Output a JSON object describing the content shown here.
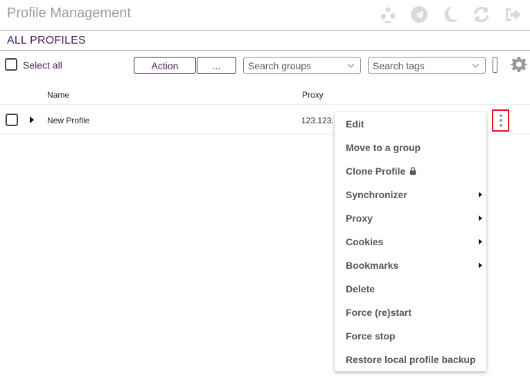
{
  "app": {
    "title": "Profile Management"
  },
  "header": {
    "icons": [
      {
        "name": "recycle-icon"
      },
      {
        "name": "telegram-icon"
      },
      {
        "name": "dark-mode-moon-icon"
      },
      {
        "name": "sync-icon"
      },
      {
        "name": "logout-icon"
      }
    ]
  },
  "section": {
    "title": "ALL PROFILES"
  },
  "toolbar": {
    "select_all_label": "Select all",
    "action_label": "Action",
    "more_label": "...",
    "groups_placeholder": "Search groups",
    "tags_placeholder": "Search tags"
  },
  "table": {
    "columns": {
      "name": "Name",
      "proxy": "Proxy"
    },
    "rows": [
      {
        "name": "New Profile",
        "proxy": "123.123."
      }
    ]
  },
  "context_menu": {
    "items": [
      {
        "label": "Edit",
        "submenu": false,
        "locked": false
      },
      {
        "label": "Move to a group",
        "submenu": false,
        "locked": false
      },
      {
        "label": "Clone Profile",
        "submenu": false,
        "locked": true
      },
      {
        "label": "Synchronizer",
        "submenu": true,
        "locked": false
      },
      {
        "label": "Proxy",
        "submenu": true,
        "locked": false
      },
      {
        "label": "Cookies",
        "submenu": true,
        "locked": false
      },
      {
        "label": "Bookmarks",
        "submenu": true,
        "locked": false
      },
      {
        "label": "Delete",
        "submenu": false,
        "locked": false
      },
      {
        "label": "Force (re)start",
        "submenu": false,
        "locked": false
      },
      {
        "label": "Force stop",
        "submenu": false,
        "locked": false
      },
      {
        "label": "Restore local profile backup",
        "submenu": false,
        "locked": false
      }
    ]
  },
  "colors": {
    "accent": "#4a1d59",
    "header_icon": "#d9d9d9",
    "highlight": "#e8111c",
    "gear": "#9a9a9a"
  }
}
